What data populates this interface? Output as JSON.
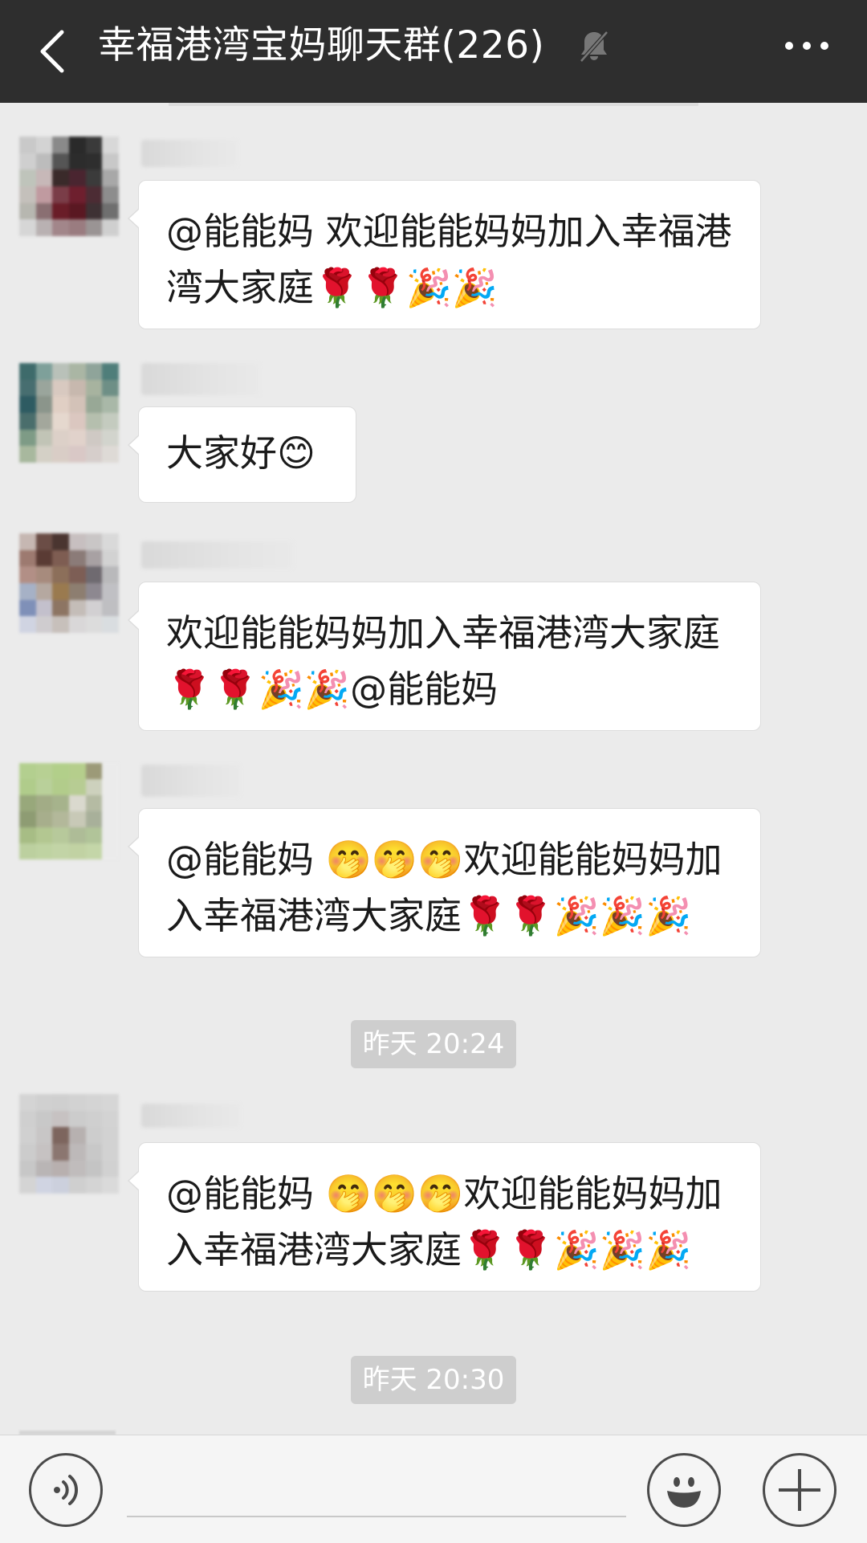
{
  "header": {
    "title": "幸福港湾宝妈聊天群(226)",
    "back_icon": "chevron-left-icon",
    "mute_icon": "bell-muted-icon",
    "more_icon": "more-dots-icon",
    "background": "#2e2e2e"
  },
  "messages": [
    {
      "text": "@能能妈  欢迎能能妈妈加入幸福港湾大家庭🌹🌹🎉🎉"
    },
    {
      "text": "大家好😊"
    },
    {
      "text": "欢迎能能妈妈加入幸福港湾大家庭🌹🌹🎉🎉@能能妈"
    },
    {
      "text": "@能能妈  🤭🤭🤭欢迎能能妈妈加入幸福港湾大家庭🌹🌹🎉🎉🎉"
    },
    {
      "text": "@能能妈  🤭🤭🤭欢迎能能妈妈加入幸福港湾大家庭🌹🌹🎉🎉🎉"
    }
  ],
  "timestamps": [
    {
      "label": "昨天 20:24"
    },
    {
      "label": "昨天 20:30"
    }
  ],
  "input_bar": {
    "voice_icon": "voice-icon",
    "emoji_icon": "emoji-icon",
    "plus_icon": "plus-icon",
    "input_value": ""
  }
}
